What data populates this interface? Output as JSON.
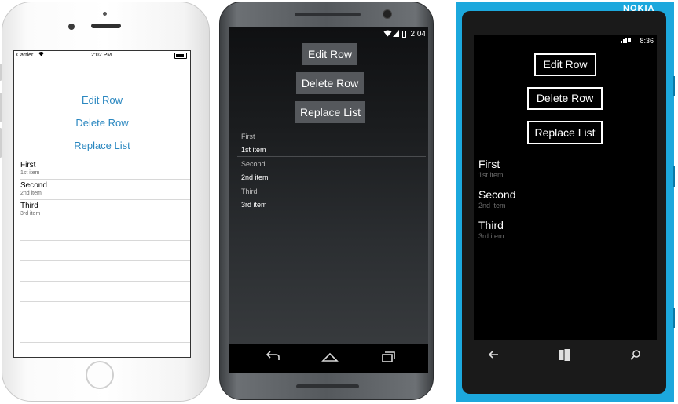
{
  "buttons": {
    "edit_row": "Edit Row",
    "delete_row": "Delete Row",
    "replace_list": "Replace List"
  },
  "items": [
    {
      "text": "First",
      "detail": "1st item"
    },
    {
      "text": "Second",
      "detail": "2nd item"
    },
    {
      "text": "Third",
      "detail": "3rd item"
    }
  ],
  "ios": {
    "carrier": "Carrier",
    "time": "2:02 PM"
  },
  "android": {
    "time": "2:04"
  },
  "windows_phone": {
    "brand": "NOKIA",
    "time": "8:36"
  },
  "colors": {
    "ios_accent": "#2a87c0",
    "lumia_body": "#1ca8dd",
    "android_button": "#55585c"
  },
  "icons": {
    "ios_wifi": "wifi-icon",
    "ios_battery": "battery-icon",
    "android_wifi": "wifi-icon",
    "android_signal": "signal-icon",
    "android_battery": "battery-icon",
    "android_back": "back-icon",
    "android_home": "home-icon",
    "android_recents": "recents-icon",
    "wp_back": "back-arrow-icon",
    "wp_start": "windows-logo-icon",
    "wp_search": "search-icon"
  }
}
